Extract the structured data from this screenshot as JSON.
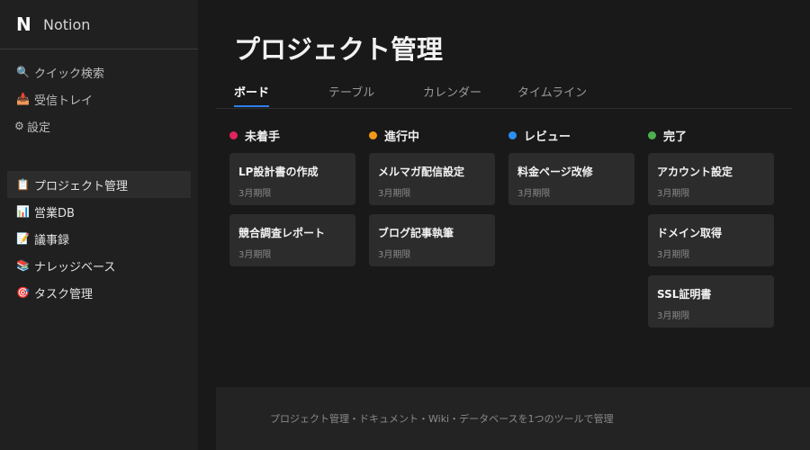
{
  "app": {
    "logo": "N",
    "name": "Notion"
  },
  "nav": [
    {
      "icon": "🔍",
      "label": "クイック検索"
    },
    {
      "icon": "📥",
      "label": "受信トレイ"
    },
    {
      "icon": "⚙",
      "label": "設定"
    }
  ],
  "pages": [
    {
      "icon": "📋",
      "label": "プロジェクト管理",
      "active": true
    },
    {
      "icon": "📊",
      "label": "営業DB"
    },
    {
      "icon": "📝",
      "label": "議事録"
    },
    {
      "icon": "📚",
      "label": "ナレッジベース"
    },
    {
      "icon": "🎯",
      "label": "タスク管理"
    }
  ],
  "page_title": "プロジェクト管理",
  "tabs": [
    {
      "label": "ボード",
      "active": true
    },
    {
      "label": "テーブル"
    },
    {
      "label": "カレンダー"
    },
    {
      "label": "タイムライン"
    }
  ],
  "columns": [
    {
      "label": "未着手",
      "color": "#e0245e",
      "cards": [
        {
          "title": "LP設計書の作成",
          "meta": "3月期限"
        },
        {
          "title": "競合調査レポート",
          "meta": "3月期限"
        }
      ]
    },
    {
      "label": "進行中",
      "color": "#f59a14",
      "cards": [
        {
          "title": "メルマガ配信設定",
          "meta": "3月期限"
        },
        {
          "title": "ブログ記事執筆",
          "meta": "3月期限"
        }
      ]
    },
    {
      "label": "レビュー",
      "color": "#2d8ff0",
      "cards": [
        {
          "title": "料金ページ改修",
          "meta": "3月期限"
        }
      ]
    },
    {
      "label": "完了",
      "color": "#4caf50",
      "cards": [
        {
          "title": "アカウント設定",
          "meta": "3月期限"
        },
        {
          "title": "ドメイン取得",
          "meta": "3月期限"
        },
        {
          "title": "SSL証明書",
          "meta": "3月期限"
        }
      ]
    }
  ],
  "footer": {
    "text": "プロジェクト管理・ドキュメント・Wiki・データベースを1つのツールで管理"
  }
}
